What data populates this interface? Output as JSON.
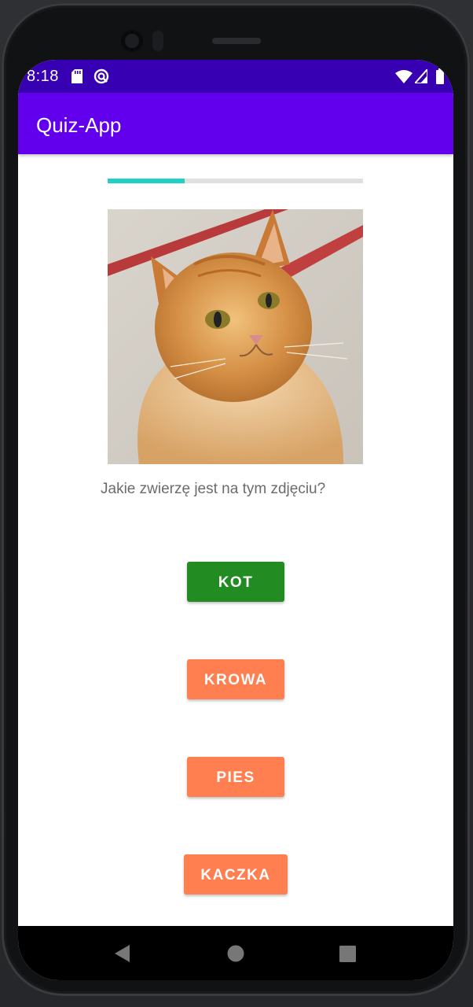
{
  "status_bar": {
    "time": "8:18",
    "icons": [
      "sd-card-icon",
      "data-saver-icon",
      "wifi-icon",
      "signal-icon",
      "battery-icon"
    ]
  },
  "app_bar": {
    "title": "Quiz-App"
  },
  "quiz": {
    "progress_fraction": 0.3,
    "image": "cat-photo",
    "question": "Jakie zwierzę jest na tym zdjęciu?",
    "answers": [
      {
        "label": "KOT",
        "state": "correct"
      },
      {
        "label": "KROWA",
        "state": "default"
      },
      {
        "label": "PIES",
        "state": "default"
      },
      {
        "label": "KACZKA",
        "state": "default"
      }
    ]
  },
  "colors": {
    "status_bar": "#3700b3",
    "app_bar": "#6200ee",
    "progress": "#1fd1c4",
    "correct_answer": "#228b22",
    "default_answer": "#ff7f50"
  },
  "nav_bar": {
    "icons": [
      "back-icon",
      "home-icon",
      "recent-apps-icon"
    ]
  }
}
